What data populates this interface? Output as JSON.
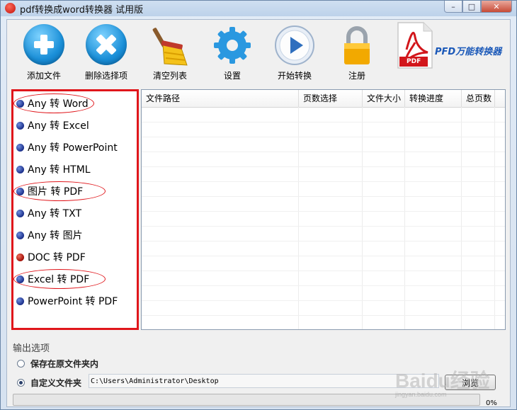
{
  "window": {
    "title": "pdf转换成word转换器 试用版",
    "controls": [
      "–",
      "□",
      "✕"
    ]
  },
  "toolbar": {
    "add_file": "添加文件",
    "remove_selected": "删除选择项",
    "clear_list": "清空列表",
    "settings": "设置",
    "start_convert": "开始转换",
    "register": "注册",
    "brand": "PFD万能转换器",
    "brand_pdf_label": "PDF"
  },
  "sidebar": {
    "items": [
      {
        "label": "Any 转 Word",
        "dot": "blue",
        "circled": true
      },
      {
        "label": "Any 转 Excel",
        "dot": "blue",
        "circled": false
      },
      {
        "label": "Any 转 PowerPoint",
        "dot": "blue",
        "circled": false
      },
      {
        "label": "Any 转 HTML",
        "dot": "blue",
        "circled": false
      },
      {
        "label": "图片 转 PDF",
        "dot": "blue",
        "circled": true
      },
      {
        "label": "Any 转 TXT",
        "dot": "blue",
        "circled": false
      },
      {
        "label": "Any 转 图片",
        "dot": "blue",
        "circled": false
      },
      {
        "label": "DOC 转 PDF",
        "dot": "red",
        "circled": false
      },
      {
        "label": "Excel 转 PDF",
        "dot": "blue",
        "circled": true
      },
      {
        "label": "PowerPoint 转 PDF",
        "dot": "blue",
        "circled": false
      }
    ]
  },
  "table": {
    "columns": [
      "文件路径",
      "页数选择",
      "文件大小",
      "转换进度",
      "总页数"
    ],
    "rows": []
  },
  "output": {
    "title": "输出选项",
    "option_original": "保存在原文件夹内",
    "option_custom": "自定义文件夹",
    "selected": "custom",
    "path": "C:\\Users\\Administrator\\Desktop",
    "browse": "浏览"
  },
  "progress": {
    "value": 0,
    "label": "0%"
  },
  "watermark": {
    "text": "Baidu经验",
    "sub": "jingyan.baidu.com"
  },
  "colors": {
    "highlight": "#e0161b",
    "progress": "#06b025"
  }
}
